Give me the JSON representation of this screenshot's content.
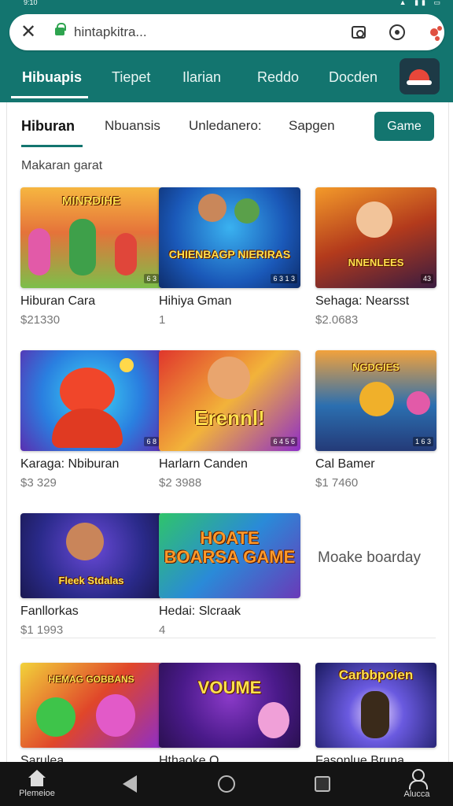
{
  "status_bar": {
    "time": "9:10",
    "icons": "▲ ▮▮ ▭"
  },
  "browser": {
    "close_icon": "✕",
    "url": "hintapkitra...",
    "buttons": [
      "camera-icon",
      "record-icon",
      "extension-icon"
    ]
  },
  "top_tabs": [
    "Hibuapis",
    "Tiepet",
    "Ilarian",
    "Reddo",
    "Docden"
  ],
  "sub_tabs": [
    "Hiburan",
    "Nbuansis",
    "Unledanero:",
    "Sapgen"
  ],
  "game_button": "Game",
  "section_label": "Makaran garat",
  "cards": [
    {
      "title": "Hiburan Cara",
      "price": "$21330",
      "art": "MINRDIHE",
      "badge": "6 3"
    },
    {
      "title": "Hihiya Gman",
      "price": "1",
      "art": "CHIENBAGP NIERIRAS",
      "badge": "6 3 1 3"
    },
    {
      "title": "Sehaga: Nearsst",
      "price": "$2.0683",
      "art": "NNENLEES",
      "badge": "43"
    },
    {
      "title": "Karaga: Nbiburan",
      "price": "$3 329",
      "art": "",
      "badge": "6 8"
    },
    {
      "title": "Harlarn Canden",
      "price": "$2 3988",
      "art": "Erennl!",
      "badge": "6 4 5 6"
    },
    {
      "title": "Cal Bamer",
      "price": "$1 7460",
      "art": "NGDGIES",
      "badge": "1 6 3"
    },
    {
      "title": "Fanllorkas",
      "price": "$1 1993",
      "art": "Fleek Stdalas"
    },
    {
      "title": "Hedai: Slcraak",
      "price": "4",
      "art": "HOATE BOARSA GAME"
    },
    {
      "title": "Sarulea",
      "price": "",
      "art": "HEMAG GOBBANS"
    },
    {
      "title": "Hthaoke O",
      "price": "",
      "art": "VOUME"
    },
    {
      "title": "Fasonlue Bruna",
      "price": "",
      "art": "Carbbpoien"
    }
  ],
  "note_text": "Moake boarday",
  "nav": {
    "home_label": "Plemeioe",
    "account_label": "Alucca"
  },
  "colors": {
    "accent": "#13756f",
    "nav_bg": "#141414"
  }
}
